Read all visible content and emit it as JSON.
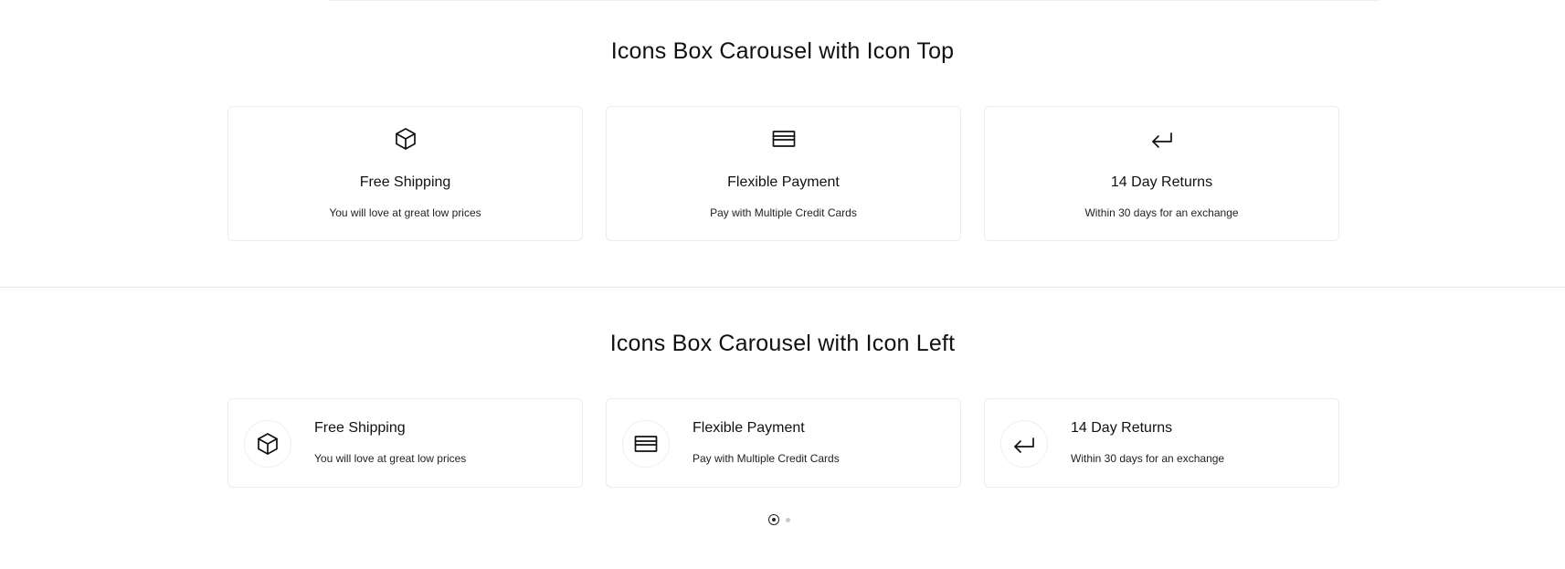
{
  "section_top": {
    "title": "Icons Box Carousel with Icon Top",
    "cards": [
      {
        "icon": "box-icon",
        "title": "Free Shipping",
        "desc": "You will love at great low prices"
      },
      {
        "icon": "credit-card-icon",
        "title": "Flexible Payment",
        "desc": "Pay with Multiple Credit Cards"
      },
      {
        "icon": "return-arrow-icon",
        "title": "14 Day Returns",
        "desc": "Within 30 days for an exchange"
      }
    ]
  },
  "section_left": {
    "title": "Icons Box Carousel with Icon Left",
    "cards": [
      {
        "icon": "box-icon",
        "title": "Free Shipping",
        "desc": "You will love at great low prices"
      },
      {
        "icon": "credit-card-icon",
        "title": "Flexible Payment",
        "desc": "Pay with Multiple Credit Cards"
      },
      {
        "icon": "return-arrow-icon",
        "title": "14 Day Returns",
        "desc": "Within 30 days for an exchange"
      }
    ]
  },
  "pagination": {
    "total_pages": 2,
    "active_page": 1
  },
  "colors": {
    "text": "#111111",
    "border": "#ececec",
    "divider": "#e6e6e6",
    "inactive_dot": "#c8c8c8"
  }
}
